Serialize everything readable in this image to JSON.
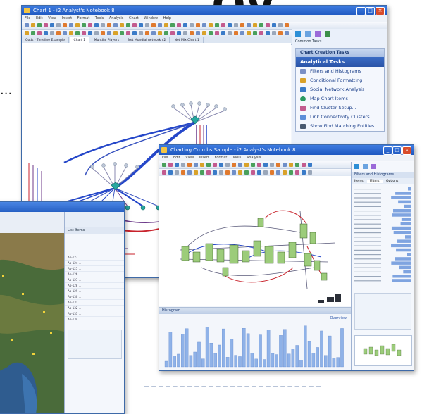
{
  "headline_fragment": "oy",
  "leader_dots": "...",
  "main_window": {
    "title": "Chart 1 - i2 Analyst's Notebook 8",
    "menu": [
      "File",
      "Edit",
      "View",
      "Insert",
      "Format",
      "Tools",
      "Analysis",
      "Chart",
      "Window",
      "Help"
    ],
    "tabs": [
      "Gods - Timeline Example",
      "Chart 1",
      "Mundial Players",
      "Net Mundial network v2",
      "Net Mix Chart 1"
    ],
    "common_tasks": "Common Tasks",
    "pane_title": "Chart Creation Tasks",
    "section": "Analytical Tasks",
    "tasks": [
      "Filters and Histograms",
      "Conditional Formatting",
      "Social Network Analysis",
      "Map Chart Items",
      "Find Cluster Setup...",
      "Link Connectivity Clusters",
      "Show Find Matching Entities"
    ]
  },
  "second_window": {
    "title": "Charting Crumbs Sample - i2 Analyst's Notebook 8",
    "pane_title": "Filters and Histograms",
    "pane_tabs": [
      "Items",
      "Filters",
      "Options"
    ],
    "bottom_panel_label": "Histogram",
    "bottom_panel_button": "Overview"
  },
  "map_window": {
    "pane_heading": "List Items",
    "rows": [
      "Ab-123 ... ",
      "Ab-124 ...",
      "Ab-125 ...",
      "Ab-126 ...",
      "Ab-127 ...",
      "Ab-128 ...",
      "Ab-129 ...",
      "Ab-130 ...",
      "Ab-131 ...",
      "Ab-132 ...",
      "Ab-133 ...",
      "Ab-134 ..."
    ]
  },
  "colors": {
    "titlebar": "#2a63cc",
    "link_blue": "#2547c9",
    "link_red": "#c8232c",
    "link_purple": "#6c3a8a",
    "node_green": "#9ccc7a",
    "bar_blue": "#8fb2e8",
    "map_green": "#4a6b3a"
  }
}
